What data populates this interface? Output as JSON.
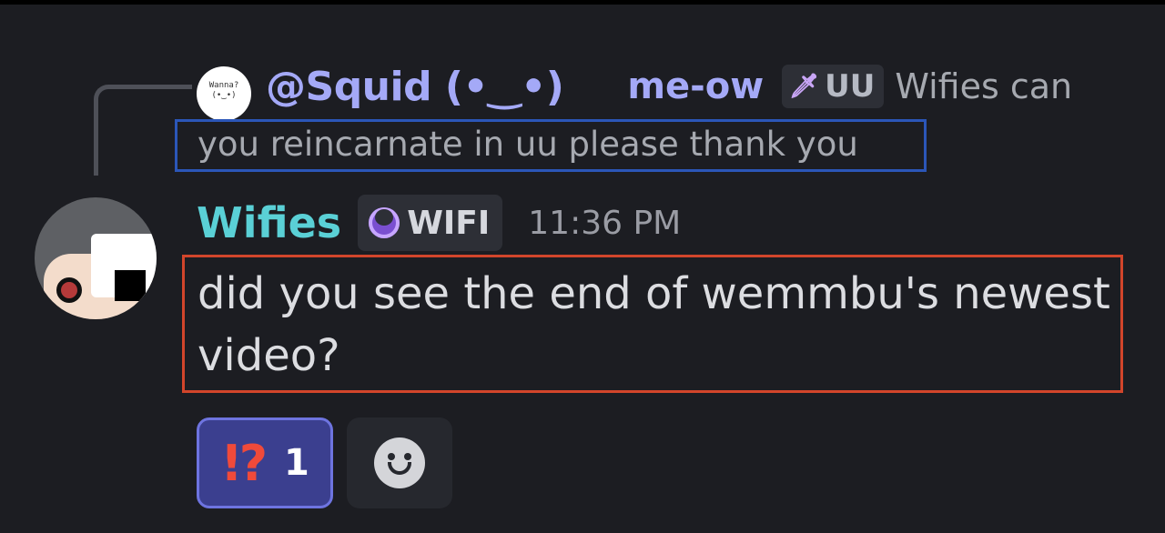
{
  "reply": {
    "avatar_text": "Wanna?\n(•‿•)",
    "author": "@Squid (•‿•)",
    "mention": "me-ow",
    "tag": "UU",
    "preview_first": "Wifies can",
    "preview_rest": "you reincarnate in uu please thank you"
  },
  "message": {
    "author": "Wifies",
    "role_tag": "WIFI",
    "timestamp": "11:36 PM",
    "text": "did you see the end of wemmbu's newest video?"
  },
  "reactions": [
    {
      "emoji": "⁉",
      "emoji_text": "!?",
      "count": "1"
    }
  ],
  "colors": {
    "background": "#1c1d22",
    "reply_author": "#a4a9f7",
    "author": "#5ad0d6",
    "highlight_blue": "#2b56b8",
    "highlight_red": "#d2452b",
    "reaction_active": "#3b3f8f"
  },
  "icons": {
    "tag_icon": "sword-icon",
    "role_icon": "moon-icon",
    "add_reaction": "smile-icon"
  }
}
